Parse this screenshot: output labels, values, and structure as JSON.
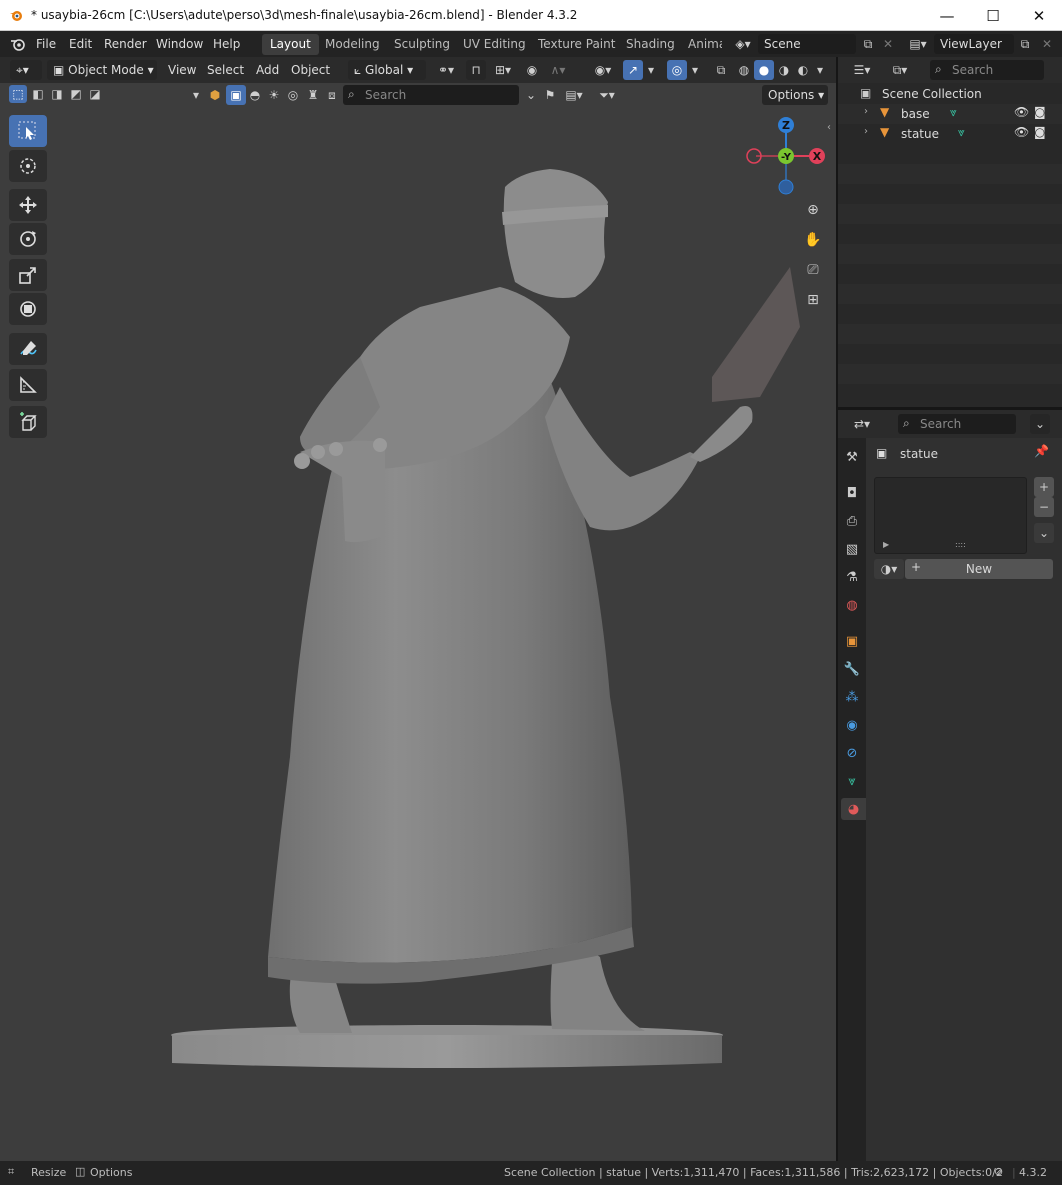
{
  "window": {
    "title": "* usaybia-26cm [C:\\Users\\adute\\perso\\3d\\mesh-finale\\usaybia-26cm.blend] - Blender 4.3.2",
    "minimize": "—",
    "maximize": "☐",
    "close": "✕"
  },
  "menu": {
    "items": [
      "File",
      "Edit",
      "Render",
      "Window",
      "Help"
    ],
    "workspaces": [
      "Layout",
      "Modeling",
      "Sculpting",
      "UV Editing",
      "Texture Paint",
      "Shading",
      "Anima"
    ],
    "active_workspace": "Layout",
    "scene_label": "Scene",
    "viewlayer_label": "ViewLayer"
  },
  "viewport_header": {
    "mode": "Object Mode",
    "menus": [
      "View",
      "Select",
      "Add",
      "Object"
    ],
    "transform_orientation": "Global",
    "search_placeholder": "Search",
    "options_label": "Options"
  },
  "outliner": {
    "search_placeholder": "Search",
    "root": "Scene Collection",
    "items": [
      {
        "label": "base"
      },
      {
        "label": "statue"
      }
    ]
  },
  "properties": {
    "search_placeholder": "Search",
    "object_name": "statue",
    "new_button": "New",
    "slot_handle": "::::"
  },
  "statusbar": {
    "left_items": [
      "Resize",
      "Options"
    ],
    "stats": "Scene Collection | statue | Verts:1,311,470 | Faces:1,311,586 | Tris:2,623,172 | Objects:0/2",
    "version": "4.3.2"
  },
  "gizmo": {
    "x_label": "X",
    "y_label": "-Y",
    "z_label": "Z",
    "colors": {
      "x": "#e0415a",
      "y": "#7ac62f",
      "z": "#2f7fd6"
    }
  },
  "colors": {
    "accent": "#4772b3",
    "mesh_icon": "#38c0a0",
    "object_icon": "#e8953a"
  }
}
